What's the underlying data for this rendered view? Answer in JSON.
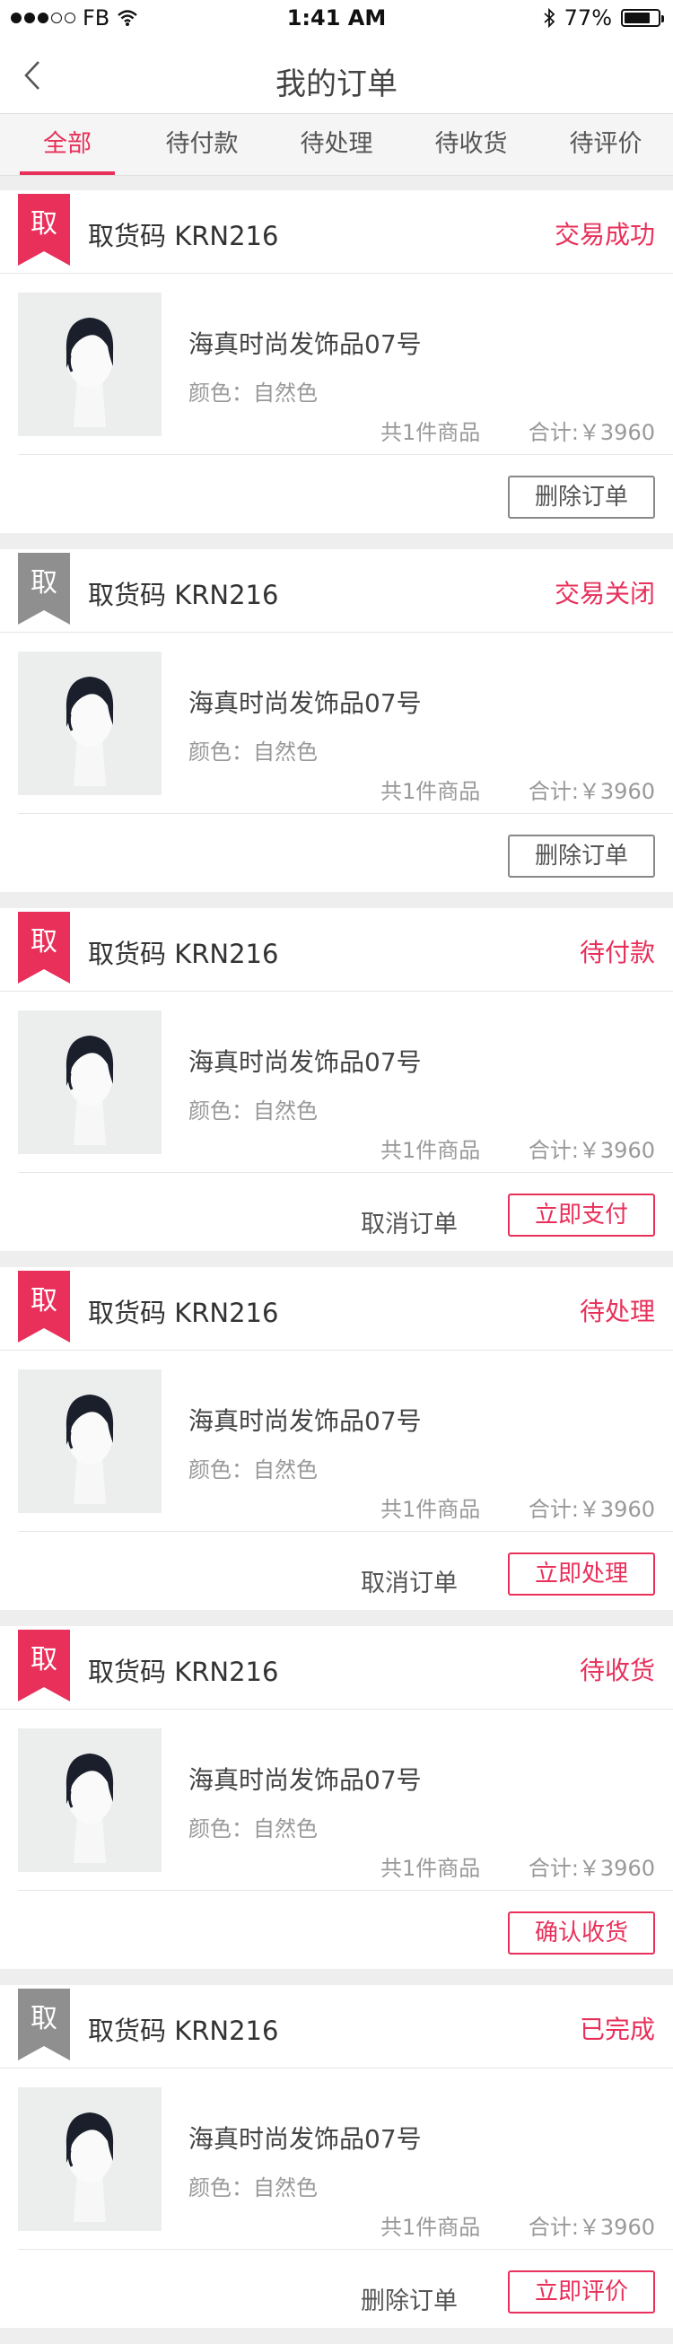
{
  "status_bar": {
    "carrier": "FB",
    "time": "1:41 AM",
    "battery": "77%",
    "battery_level": 0.77
  },
  "nav": {
    "title": "我的订单"
  },
  "tabs": [
    {
      "label": "全部",
      "active": true
    },
    {
      "label": "待付款",
      "active": false
    },
    {
      "label": "待处理",
      "active": false
    },
    {
      "label": "待收货",
      "active": false
    },
    {
      "label": "待评价",
      "active": false
    }
  ],
  "orders": [
    {
      "ribbon_char": "取",
      "ribbon_color": "red",
      "pickup_code": "取货码 KRN216",
      "status": "交易成功",
      "product": "海真时尚发饰品07号",
      "color_text": "颜色：自然色",
      "qty_text": "共1件商品",
      "total_text": "合计:￥3960",
      "plain_action": "",
      "box_action": "删除订单",
      "box_style": "gray"
    },
    {
      "ribbon_char": "取",
      "ribbon_color": "gray",
      "pickup_code": "取货码 KRN216",
      "status": "交易关闭",
      "product": "海真时尚发饰品07号",
      "color_text": "颜色：自然色",
      "qty_text": "共1件商品",
      "total_text": "合计:￥3960",
      "plain_action": "",
      "box_action": "删除订单",
      "box_style": "gray"
    },
    {
      "ribbon_char": "取",
      "ribbon_color": "red",
      "pickup_code": "取货码 KRN216",
      "status": "待付款",
      "product": "海真时尚发饰品07号",
      "color_text": "颜色：自然色",
      "qty_text": "共1件商品",
      "total_text": "合计:￥3960",
      "plain_action": "取消订单",
      "box_action": "立即支付",
      "box_style": "red"
    },
    {
      "ribbon_char": "取",
      "ribbon_color": "red",
      "pickup_code": "取货码 KRN216",
      "status": "待处理",
      "product": "海真时尚发饰品07号",
      "color_text": "颜色：自然色",
      "qty_text": "共1件商品",
      "total_text": "合计:￥3960",
      "plain_action": "取消订单",
      "box_action": "立即处理",
      "box_style": "red"
    },
    {
      "ribbon_char": "取",
      "ribbon_color": "red",
      "pickup_code": "取货码 KRN216",
      "status": "待收货",
      "product": "海真时尚发饰品07号",
      "color_text": "颜色：自然色",
      "qty_text": "共1件商品",
      "total_text": "合计:￥3960",
      "plain_action": "",
      "box_action": "确认收货",
      "box_style": "red"
    },
    {
      "ribbon_char": "取",
      "ribbon_color": "gray",
      "pickup_code": "取货码 KRN216",
      "status": "已完成",
      "product": "海真时尚发饰品07号",
      "color_text": "颜色：自然色",
      "qty_text": "共1件商品",
      "total_text": "合计:￥3960",
      "plain_action": "删除订单",
      "box_action": "立即评价",
      "box_style": "red"
    }
  ],
  "colors": {
    "accent": "#e8305a",
    "muted": "#999999",
    "ribbon_gray": "#8f8f8f"
  },
  "icons": {
    "back": "chevron-left-icon",
    "wifi": "wifi-icon",
    "bluetooth": "bluetooth-icon",
    "battery": "battery-icon",
    "product": "wig-mannequin-icon"
  }
}
